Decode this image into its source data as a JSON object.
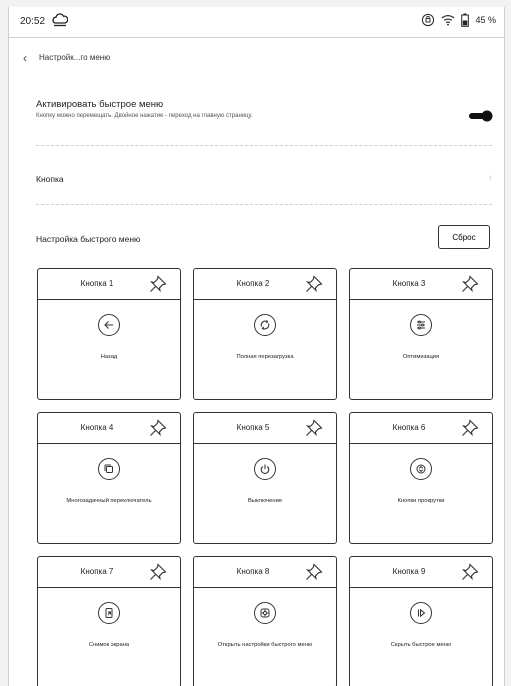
{
  "status": {
    "time": "20:52",
    "battery": "45 %"
  },
  "nav": {
    "title": "Настройк...го меню"
  },
  "quick_menu": {
    "title": "Активировать быстрое меню",
    "subtitle": "Кнопку можно перемещать. Двойное нажатие - переход на главную страницу."
  },
  "button_row": {
    "label": "Кнопка"
  },
  "config": {
    "label": "Настройка быстрого меню",
    "reset": "Сброс"
  },
  "cards": [
    {
      "title": "Кнопка 1",
      "label": "Назад",
      "icon": "back-arrow-icon"
    },
    {
      "title": "Кнопка 2",
      "label": "Полная перезагрузка",
      "icon": "refresh-icon"
    },
    {
      "title": "Кнопка 3",
      "label": "Оптимизация",
      "icon": "optimize-icon"
    },
    {
      "title": "Кнопка 4",
      "label": "Многозадачный переключатель",
      "icon": "multitask-icon"
    },
    {
      "title": "Кнопка 5",
      "label": "Выключение",
      "icon": "power-icon"
    },
    {
      "title": "Кнопка 6",
      "label": "Кнопки прокрутки",
      "icon": "scroll-buttons-icon"
    },
    {
      "title": "Кнопка 7",
      "label": "Снимок экрана",
      "icon": "screenshot-icon"
    },
    {
      "title": "Кнопка 8",
      "label": "Открыть настройки быстрого меню",
      "icon": "settings-icon"
    },
    {
      "title": "Кнопка 9",
      "label": "Скрыть быстрое меню",
      "icon": "hide-menu-icon"
    }
  ]
}
